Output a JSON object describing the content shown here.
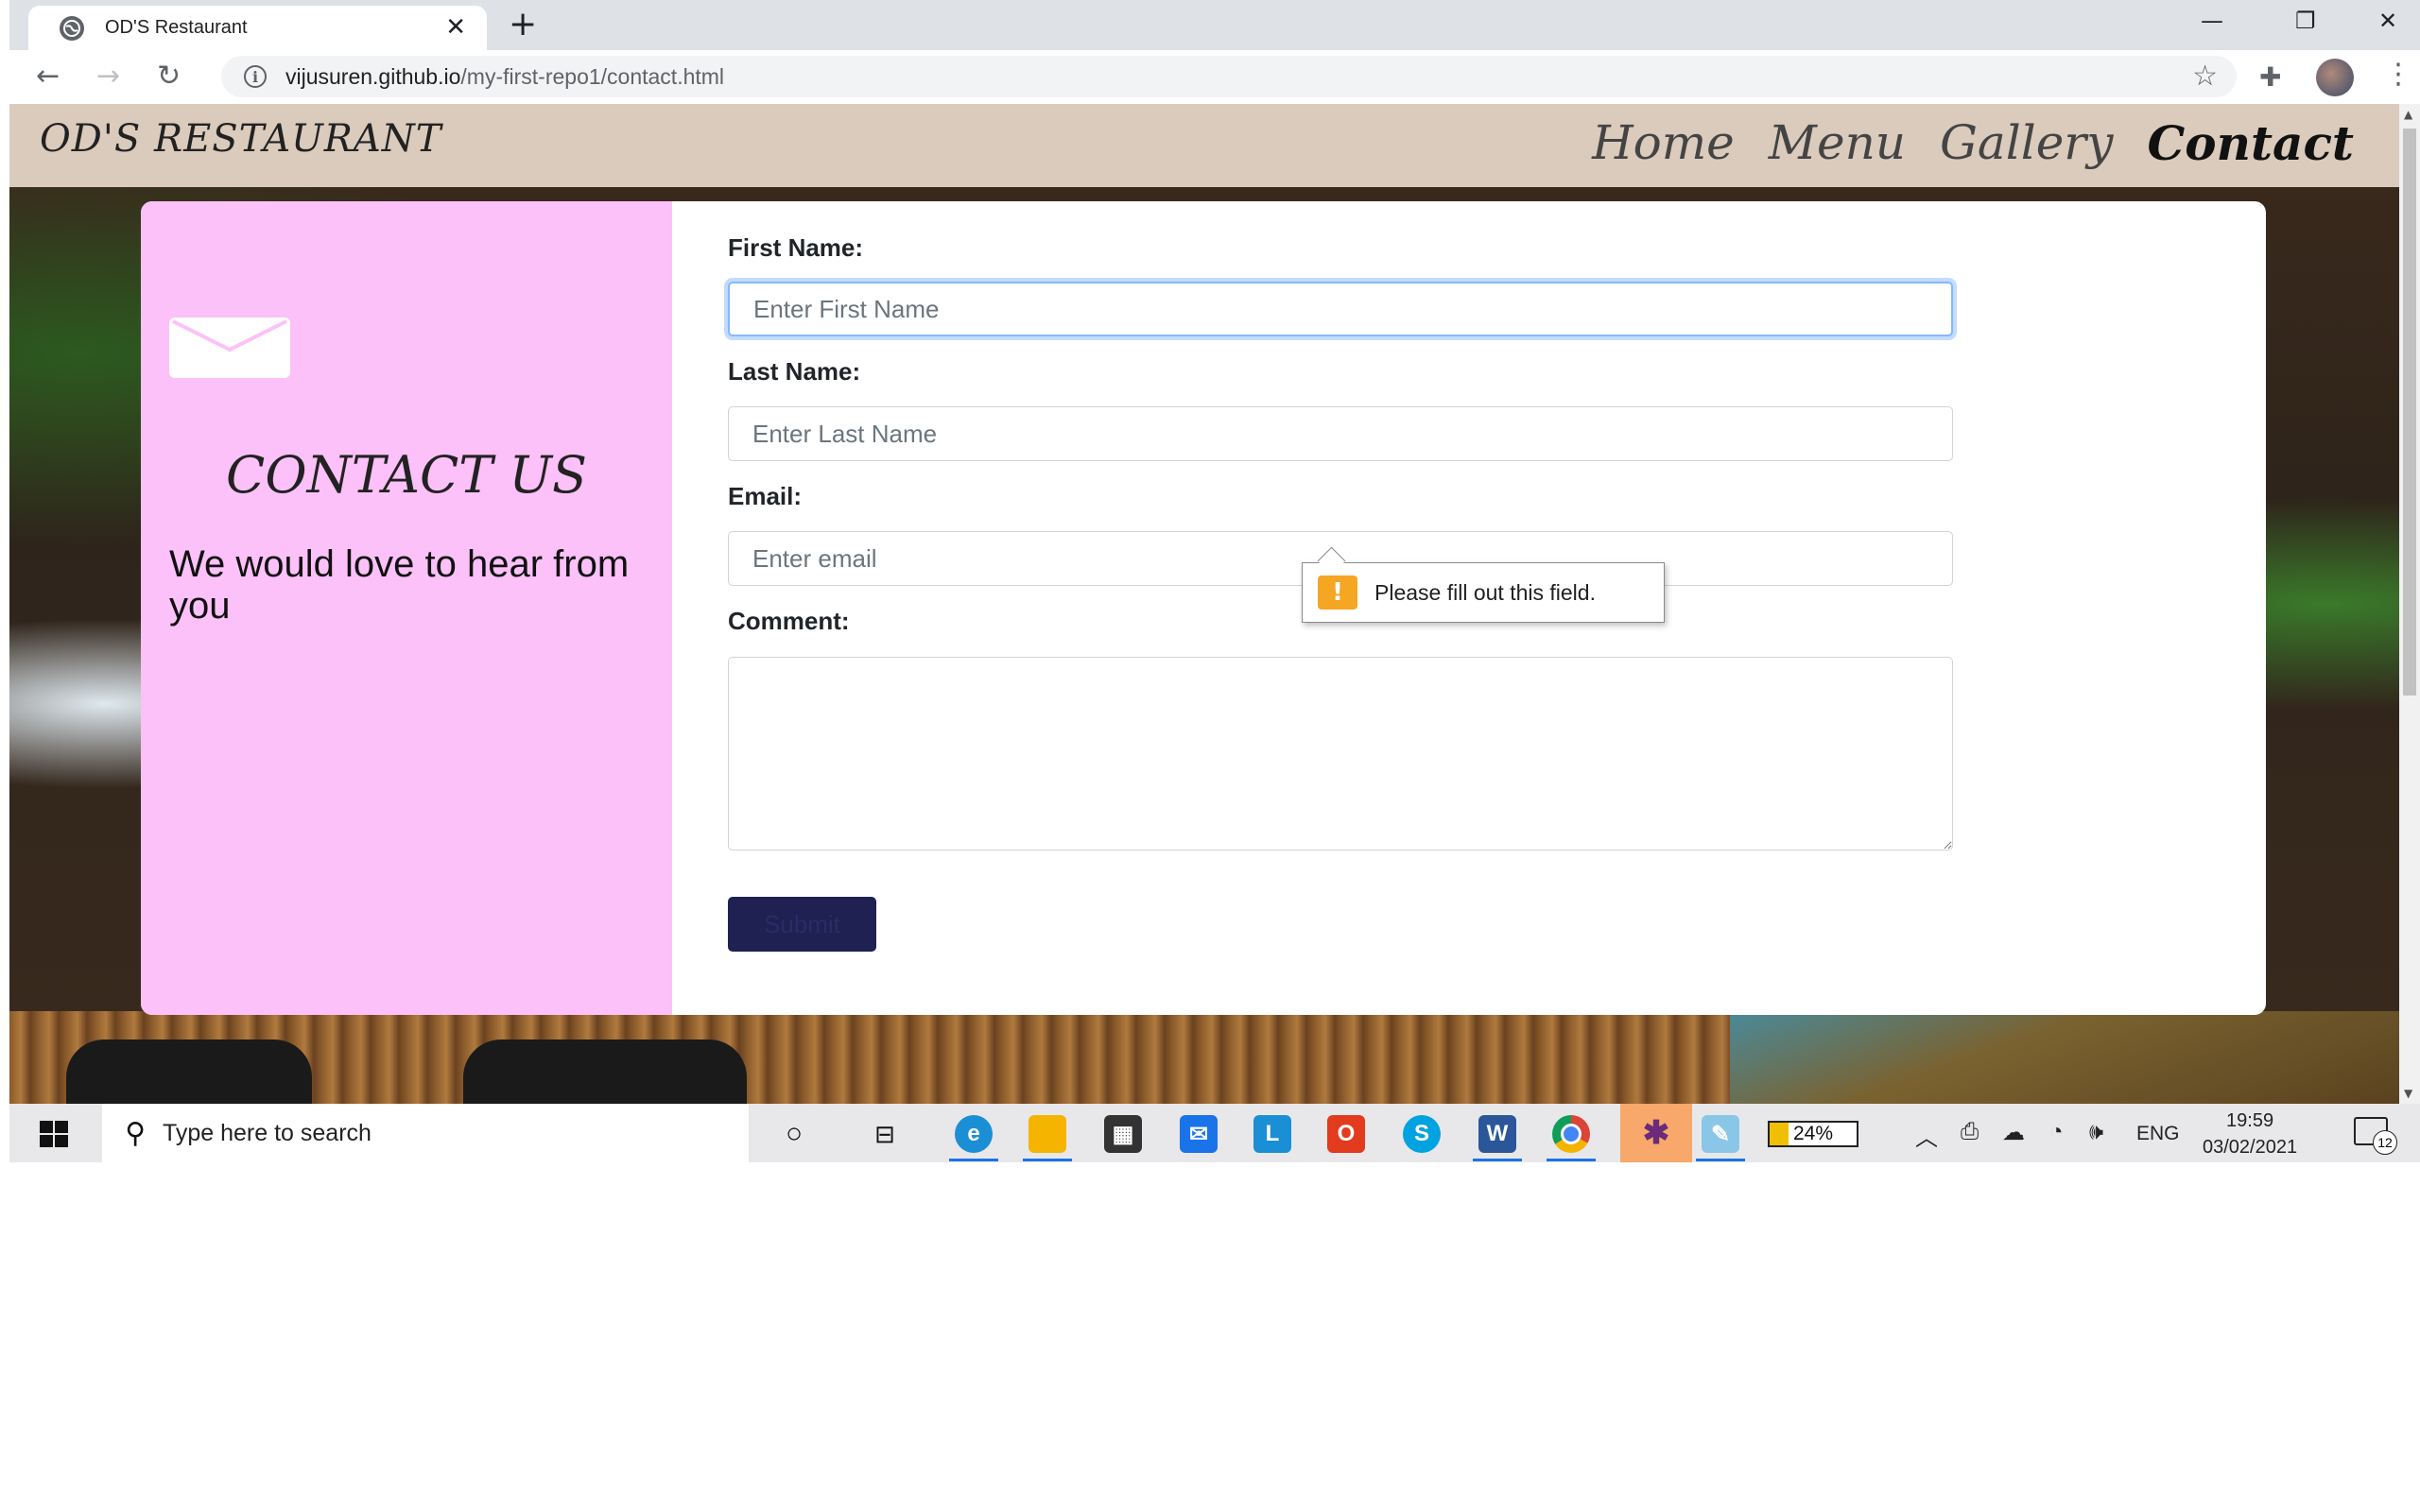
{
  "browser": {
    "tab_title": "OD'S Restaurant",
    "tab_close": "✕",
    "new_tab": "+",
    "url_host": "vijusuren.github.io",
    "url_path": "/my-first-repo1/contact.html",
    "controls": {
      "minimize": "—",
      "restore": "❐",
      "close": "✕"
    }
  },
  "site": {
    "brand": "OD'S RESTAURANT",
    "nav": [
      {
        "label": "Home",
        "active": false
      },
      {
        "label": "Menu",
        "active": false
      },
      {
        "label": "Gallery",
        "active": false
      },
      {
        "label": "Contact",
        "active": true
      }
    ]
  },
  "contact": {
    "title": "CONTACT US",
    "subtitle": "We would love to hear from you",
    "form": {
      "first_name_label": "First Name:",
      "first_name_placeholder": "Enter First Name",
      "last_name_label": "Last Name:",
      "last_name_placeholder": "Enter Last Name",
      "email_label": "Email:",
      "email_placeholder": "Enter email",
      "comment_label": "Comment:",
      "submit_label": "Submit"
    },
    "validation_tooltip": "Please fill out this field."
  },
  "taskbar": {
    "search_placeholder": "Type here to search",
    "battery": "24%",
    "language": "ENG",
    "time": "19:59",
    "date": "03/02/2021",
    "notification_count": "12",
    "apps": [
      "cortana-icon",
      "task-view-icon",
      "edge-icon",
      "file-explorer-icon",
      "store-icon",
      "mail-icon",
      "l-app-icon",
      "office-icon",
      "skype-icon",
      "word-icon",
      "chrome-icon",
      "slack-icon",
      "paint-icon"
    ]
  },
  "colors": {
    "header_bg": "#dbcbbd",
    "contact_panel_bg": "#fcc1f8",
    "submit_bg": "#1f2152",
    "focus_ring": "#86b7fe"
  }
}
